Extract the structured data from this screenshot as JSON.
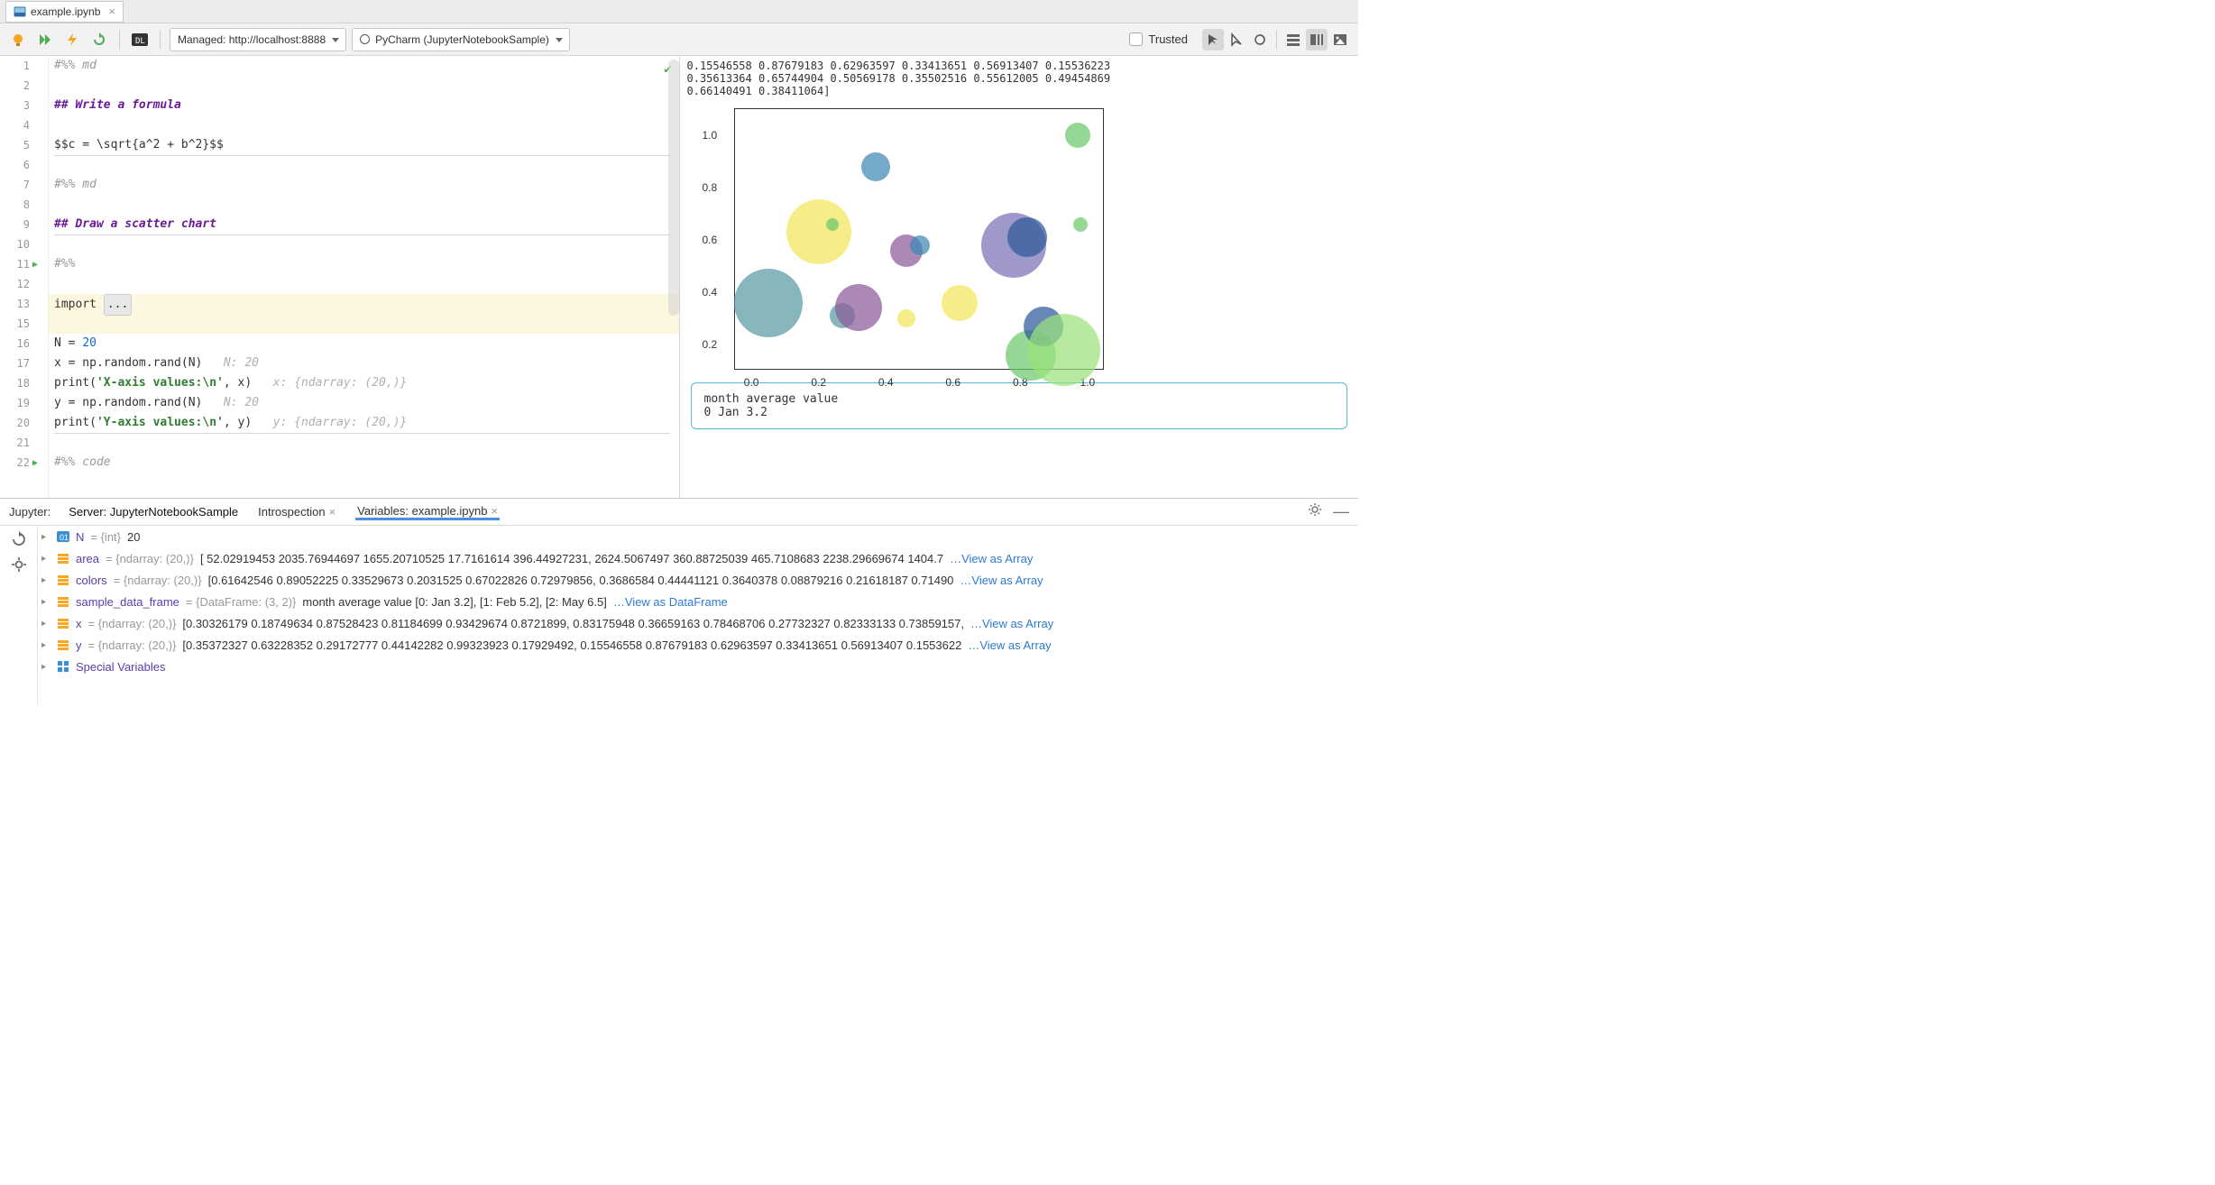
{
  "tab": {
    "filename": "example.ipynb"
  },
  "toolbar": {
    "managed": "Managed: http://localhost:8888",
    "kernel": "PyCharm (JupyterNotebookSample)",
    "trusted": "Trusted"
  },
  "gutter": [
    "1",
    "2",
    "3",
    "4",
    "5",
    "6",
    "7",
    "8",
    "9",
    "10",
    "11",
    "12",
    "13",
    "15",
    "16",
    "17",
    "18",
    "19",
    "20",
    "21",
    "22"
  ],
  "code": {
    "l1": "#%% md",
    "l3": "## Write a formula",
    "l5": "$$c = \\sqrt{a^2 + b^2}$$",
    "l7": "#%% md",
    "l9": "## Draw a scatter chart",
    "l11": "#%%",
    "l13a": "import ",
    "l13b": "...",
    "l16a": "N = ",
    "l16b": "20",
    "l17a": "x = np.random.rand(N)",
    "l17h": "   N: 20",
    "l18a": "print(",
    "l18b": "'X-axis values:\\n'",
    "l18c": ", x)",
    "l18h": "   x: {ndarray: (20,)}",
    "l19a": "y = np.random.rand(N)",
    "l19h": "   N: 20",
    "l20a": "print(",
    "l20b": "'Y-axis values:\\n'",
    "l20c": ", y)",
    "l20h": "   y: {ndarray: (20,)}",
    "l22": "#%% code"
  },
  "output_numbers": [
    "0.15546558  0.87679183  0.62963597  0.33413651  0.56913407  0.15536223",
    "0.35613364  0.65744904  0.50569178  0.35502516  0.55612005  0.49454869",
    "0.66140491  0.38411064]"
  ],
  "chart_data": {
    "type": "scatter",
    "xlabel": "",
    "ylabel": "",
    "xlim": [
      -0.05,
      1.05
    ],
    "ylim": [
      0.1,
      1.1
    ],
    "xticks": [
      0.0,
      0.2,
      0.4,
      0.6,
      0.8,
      1.0
    ],
    "yticks": [
      0.2,
      0.4,
      0.6,
      0.8,
      1.0
    ],
    "points": [
      {
        "x": 0.05,
        "y": 0.36,
        "r": 38,
        "c": "#5a9aa3"
      },
      {
        "x": 0.2,
        "y": 0.63,
        "r": 36,
        "c": "#f2e65a"
      },
      {
        "x": 0.24,
        "y": 0.66,
        "r": 7,
        "c": "#6cc76c"
      },
      {
        "x": 0.27,
        "y": 0.31,
        "r": 14,
        "c": "#5a9aa3"
      },
      {
        "x": 0.32,
        "y": 0.34,
        "r": 26,
        "c": "#8b5a9a"
      },
      {
        "x": 0.37,
        "y": 0.88,
        "r": 16,
        "c": "#3f88b5"
      },
      {
        "x": 0.46,
        "y": 0.3,
        "r": 10,
        "c": "#f2e65a"
      },
      {
        "x": 0.46,
        "y": 0.56,
        "r": 18,
        "c": "#8b5a9a"
      },
      {
        "x": 0.5,
        "y": 0.58,
        "r": 11,
        "c": "#3f88b5"
      },
      {
        "x": 0.62,
        "y": 0.36,
        "r": 20,
        "c": "#f2e65a"
      },
      {
        "x": 0.78,
        "y": 0.58,
        "r": 36,
        "c": "#7a70b5"
      },
      {
        "x": 0.82,
        "y": 0.61,
        "r": 22,
        "c": "#2d5a9a"
      },
      {
        "x": 0.83,
        "y": 0.16,
        "r": 28,
        "c": "#6cc76c"
      },
      {
        "x": 0.87,
        "y": 0.27,
        "r": 22,
        "c": "#2d5a9a"
      },
      {
        "x": 0.93,
        "y": 0.18,
        "r": 40,
        "c": "#9be27b"
      },
      {
        "x": 0.98,
        "y": 0.66,
        "r": 8,
        "c": "#6cc76c"
      },
      {
        "x": 0.97,
        "y": 1.0,
        "r": 14,
        "c": "#6cc76c"
      }
    ]
  },
  "table_output": {
    "header": "   month  average value",
    "row": "0    Jan            3.2"
  },
  "bottom": {
    "label": "Jupyter:",
    "server": "Server: JupyterNotebookSample",
    "introspection": "Introspection",
    "variables": "Variables: example.ipynb"
  },
  "vars": [
    {
      "icon": "int",
      "name": "N",
      "type": " = {int} ",
      "val": "20",
      "link": ""
    },
    {
      "icon": "arr",
      "name": "area",
      "type": " = {ndarray: (20,)} ",
      "val": "[   52.02919453 2035.76944697 1655.20710525   17.7161614    396.44927231, 2624.5067497    360.88725039  465.7108683  2238.29669674 1404.7",
      "link": "…View as Array"
    },
    {
      "icon": "arr",
      "name": "colors",
      "type": " = {ndarray: (20,)} ",
      "val": "[0.61642546 0.89052225 0.33529673 0.2031525  0.67022826 0.72979856, 0.3686584  0.44441121 0.3640378  0.08879216 0.21618187 0.71490",
      "link": "…View as Array"
    },
    {
      "icon": "arr",
      "name": "sample_data_frame",
      "type": " = {DataFrame: (3, 2)} ",
      "val": "month average value [0: Jan 3.2], [1: Feb 5.2], [2: May 6.5] ",
      "link": "…View as DataFrame"
    },
    {
      "icon": "arr",
      "name": "x",
      "type": " = {ndarray: (20,)} ",
      "val": "[0.30326179 0.18749634 0.87528423 0.81184699 0.93429674 0.8721899, 0.83175948 0.36659163 0.78468706 0.27732327 0.82333133 0.73859157, ",
      "link": "…View as Array"
    },
    {
      "icon": "arr",
      "name": "y",
      "type": " = {ndarray: (20,)} ",
      "val": "[0.35372327 0.63228352 0.29172777 0.44142282 0.99323923 0.17929492, 0.15546558 0.87679183 0.62963597 0.33413651 0.56913407 0.1553622",
      "link": "…View as Array"
    },
    {
      "icon": "sp",
      "name": "Special Variables",
      "type": "",
      "val": "",
      "link": ""
    }
  ]
}
